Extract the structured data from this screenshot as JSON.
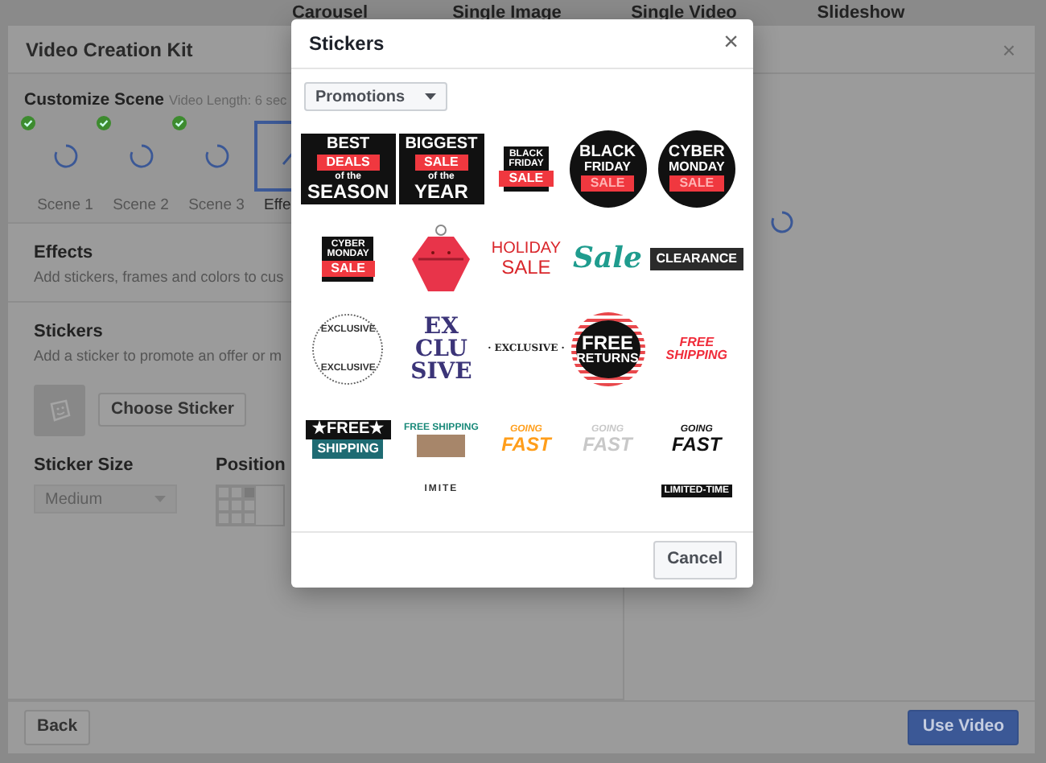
{
  "background_tabs": [
    {
      "label": "Carousel",
      "selected": false
    },
    {
      "label": "Single Image",
      "selected": false
    },
    {
      "label": "Single Video",
      "selected": false
    },
    {
      "label": "Slideshow",
      "selected": false
    }
  ],
  "dialog": {
    "title": "Video Creation Kit",
    "close": "×",
    "customize": {
      "title": "Customize Scene",
      "video_length": "Video Length: 6 sec",
      "scenes": [
        {
          "label": "Scene 1",
          "kind": "scene",
          "done": true,
          "selected": false
        },
        {
          "label": "Scene 2",
          "kind": "scene",
          "done": true,
          "selected": false
        },
        {
          "label": "Scene 3",
          "kind": "scene",
          "done": true,
          "selected": false
        },
        {
          "label": "Effe",
          "kind": "effects",
          "done": false,
          "selected": true
        }
      ]
    },
    "effects": {
      "title": "Effects",
      "description": "Add stickers, frames and colors to cus"
    },
    "stickers": {
      "title": "Stickers",
      "description": "Add a sticker to promote an offer or m",
      "button": "Choose Sticker",
      "size_label": "Sticker Size",
      "size_value": "Medium",
      "size_disabled": true,
      "position_label": "Position",
      "position_cells": [
        {
          "selected": false
        },
        {
          "selected": false
        },
        {
          "selected": true
        },
        {
          "selected": false
        },
        {
          "selected": false
        },
        {
          "selected": false
        },
        {
          "selected": false
        },
        {
          "selected": false
        },
        {
          "selected": false
        }
      ]
    },
    "back_button": "Back",
    "use_button": "Use Video"
  },
  "sticker_modal": {
    "title": "Stickers",
    "close": "×",
    "category": "Promotions",
    "cancel": "Cancel",
    "stickers": [
      {
        "kind": "tag",
        "lines": [
          "BEST",
          "DEALS",
          "of the",
          "SEASON"
        ]
      },
      {
        "kind": "tag",
        "lines": [
          "BIGGEST",
          "SALE",
          "of the",
          "YEAR"
        ]
      },
      {
        "kind": "smalltag",
        "lines": [
          "BLACK",
          "FRIDAY",
          "SALE"
        ]
      },
      {
        "kind": "seal",
        "lines": [
          "BLACK",
          "FRIDAY",
          "SALE"
        ]
      },
      {
        "kind": "seal",
        "lines": [
          "CYBER",
          "MONDAY",
          "SALE"
        ]
      },
      {
        "kind": "smalltag",
        "lines": [
          "CYBER",
          "MONDAY",
          "SALE"
        ]
      },
      {
        "kind": "ornament"
      },
      {
        "kind": "holiday",
        "lines": [
          "HOLIDAY",
          "SALE"
        ]
      },
      {
        "kind": "script",
        "lines": [
          "Sale"
        ]
      },
      {
        "kind": "banner",
        "lines": [
          "CLEARANCE"
        ]
      },
      {
        "kind": "ring",
        "lines": [
          "EXCLUSIVE",
          "EXCLUSIVE"
        ]
      },
      {
        "kind": "serifstack",
        "lines": [
          "EX",
          "CLU",
          "SIVE"
        ]
      },
      {
        "kind": "serifline",
        "lines": [
          "· EXCLUSIVE ·"
        ]
      },
      {
        "kind": "stripes",
        "lines": [
          "FREE",
          "RETURNS"
        ]
      },
      {
        "kind": "italicred",
        "lines": [
          "FREE",
          "SHIPPING"
        ]
      },
      {
        "kind": "flag",
        "lines": [
          "★FREE★",
          "SHIPPING"
        ]
      },
      {
        "kind": "box",
        "lines": [
          "FREE SHIPPING"
        ]
      },
      {
        "kind": "fast",
        "lines": [
          "GOING",
          "FAST"
        ]
      },
      {
        "kind": "ghost",
        "lines": [
          "GOING",
          "FAST"
        ]
      },
      {
        "kind": "fastblack",
        "lines": [
          "GOING",
          "FAST"
        ]
      },
      {
        "kind": "partial"
      },
      {
        "kind": "arc",
        "lines": [
          "IMITE"
        ]
      },
      {
        "kind": "partial"
      },
      {
        "kind": "partial"
      },
      {
        "kind": "strip",
        "lines": [
          "LIMITED-TIME"
        ]
      }
    ]
  }
}
